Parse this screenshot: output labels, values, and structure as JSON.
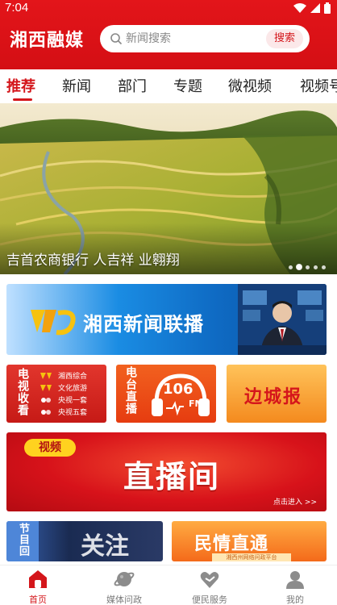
{
  "status_bar": {
    "time": "7:04"
  },
  "header": {
    "logo_text": "湘西融媒",
    "search_placeholder": "新闻搜索",
    "search_button": "搜索"
  },
  "tabs": [
    "推荐",
    "新闻",
    "部门",
    "专题",
    "微视频",
    "视频号"
  ],
  "active_tab": "推荐",
  "banner": {
    "caption": "吉首农商银行 人吉祥 业翱翔",
    "dot_count": 5,
    "active_dot": 2
  },
  "cards": {
    "news_broadcast": {
      "title": "湘西新闻联播"
    },
    "tv": {
      "label": "电视收看",
      "channels": [
        "湘西综合",
        "文化旅游",
        "央视一套",
        "央视五套"
      ]
    },
    "radio": {
      "label": "电台直播",
      "freq": "106",
      "unit": "FM"
    },
    "biancheng": {
      "title": "边城报"
    },
    "live": {
      "badge": "视频",
      "title": "直播间",
      "enter": "点击进入 >>"
    },
    "program": {
      "label": "节目回",
      "calligraphy": "关注"
    },
    "minqing": {
      "title": "民情直通",
      "sub": "湘西州网络问政平台"
    }
  },
  "bottom_nav": [
    {
      "label": "首页",
      "icon": "home-icon",
      "active": true
    },
    {
      "label": "媒体问政",
      "icon": "planet-icon",
      "active": false
    },
    {
      "label": "便民服务",
      "icon": "heart-hands-icon",
      "active": false
    },
    {
      "label": "我的",
      "icon": "user-icon",
      "active": false
    }
  ],
  "colors": {
    "brand_red": "#d4161b",
    "header_red": "#e3151a",
    "inactive_gray": "#7a7a7a"
  }
}
